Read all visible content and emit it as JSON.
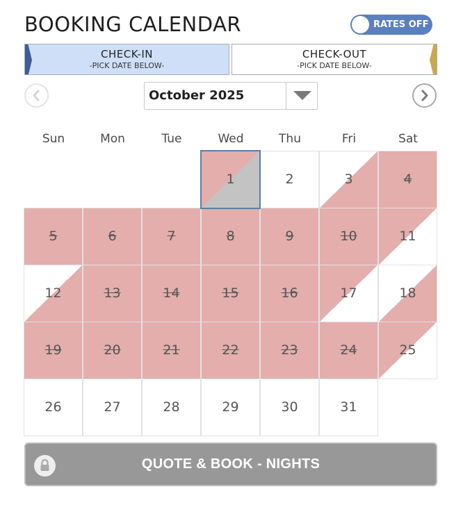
{
  "header": {
    "title": "BOOKING CALENDAR"
  },
  "rates_toggle": {
    "label": "RATES OFF",
    "state": "off"
  },
  "tabs": {
    "checkin": {
      "label": "CHECK-IN",
      "hint": "-PICK DATE BELOW-",
      "active": true,
      "edge_color": "#3f5d9a"
    },
    "checkout": {
      "label": "CHECK-OUT",
      "hint": "-PICK DATE BELOW-",
      "active": false,
      "edge_color": "#c9a94e"
    }
  },
  "month_nav": {
    "prev_icon": "chevron-left-icon",
    "next_icon": "chevron-right-icon",
    "selected_month": "October 2025",
    "dropdown_icon": "caret-down-icon"
  },
  "weekdays": [
    "Sun",
    "Mon",
    "Tue",
    "Wed",
    "Thu",
    "Fri",
    "Sat"
  ],
  "calendar": {
    "first_weekday_index": 3,
    "days": [
      {
        "d": "1",
        "status": "today"
      },
      {
        "d": "2",
        "status": "available"
      },
      {
        "d": "3",
        "status": "checkin"
      },
      {
        "d": "4",
        "status": "booked"
      },
      {
        "d": "5",
        "status": "booked"
      },
      {
        "d": "6",
        "status": "booked"
      },
      {
        "d": "7",
        "status": "booked"
      },
      {
        "d": "8",
        "status": "booked"
      },
      {
        "d": "9",
        "status": "booked"
      },
      {
        "d": "10",
        "status": "booked"
      },
      {
        "d": "11",
        "status": "checkout"
      },
      {
        "d": "12",
        "status": "checkin"
      },
      {
        "d": "13",
        "status": "booked"
      },
      {
        "d": "14",
        "status": "booked"
      },
      {
        "d": "15",
        "status": "booked"
      },
      {
        "d": "16",
        "status": "booked"
      },
      {
        "d": "17",
        "status": "checkout"
      },
      {
        "d": "18",
        "status": "checkin"
      },
      {
        "d": "19",
        "status": "booked"
      },
      {
        "d": "20",
        "status": "booked"
      },
      {
        "d": "21",
        "status": "booked"
      },
      {
        "d": "22",
        "status": "booked"
      },
      {
        "d": "23",
        "status": "booked"
      },
      {
        "d": "24",
        "status": "booked"
      },
      {
        "d": "25",
        "status": "checkout"
      },
      {
        "d": "26",
        "status": "available"
      },
      {
        "d": "27",
        "status": "available"
      },
      {
        "d": "28",
        "status": "available"
      },
      {
        "d": "29",
        "status": "available"
      },
      {
        "d": "30",
        "status": "available"
      },
      {
        "d": "31",
        "status": "available"
      }
    ]
  },
  "colors": {
    "booked": "#e3aeac",
    "today_fill": "#c3c3c3",
    "today_border": "#5a7fa6",
    "toggle_bg": "#5b7fbf",
    "button_bg": "#989898"
  },
  "quote_button": {
    "label": "QUOTE & BOOK - NIGHTS",
    "icon": "lock-icon"
  }
}
